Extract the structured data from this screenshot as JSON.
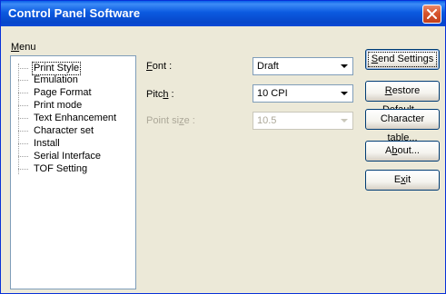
{
  "window": {
    "title": "Control Panel Software"
  },
  "menu": {
    "label_first": "M",
    "label_rest": "enu",
    "items": [
      {
        "label": "Print Style",
        "selected": true
      },
      {
        "label": "Emulation"
      },
      {
        "label": "Page Format"
      },
      {
        "label": "Print mode"
      },
      {
        "label": "Text Enhancement"
      },
      {
        "label": "Character set"
      },
      {
        "label": "Install"
      },
      {
        "label": "Serial Interface"
      },
      {
        "label": "TOF Setting"
      }
    ]
  },
  "fields": {
    "font": {
      "label_a": "",
      "label_u": "F",
      "label_b": "ont :",
      "value": "Draft"
    },
    "pitch": {
      "label_a": "Pitc",
      "label_u": "h",
      "label_b": " :",
      "value": "10 CPI"
    },
    "point_size": {
      "label_a": "Point si",
      "label_u": "z",
      "label_b": "e :",
      "value": "10.5",
      "disabled": true
    }
  },
  "buttons": {
    "send": {
      "a": "",
      "u": "S",
      "b": "end Settings"
    },
    "restore": {
      "a": "",
      "u": "R",
      "b": "estore Default..."
    },
    "chartable": {
      "a": "Character ",
      "u": "t",
      "b": "able..."
    },
    "about": {
      "a": "A",
      "u": "b",
      "b": "out..."
    },
    "exit": {
      "a": "E",
      "u": "x",
      "b": "it"
    }
  }
}
